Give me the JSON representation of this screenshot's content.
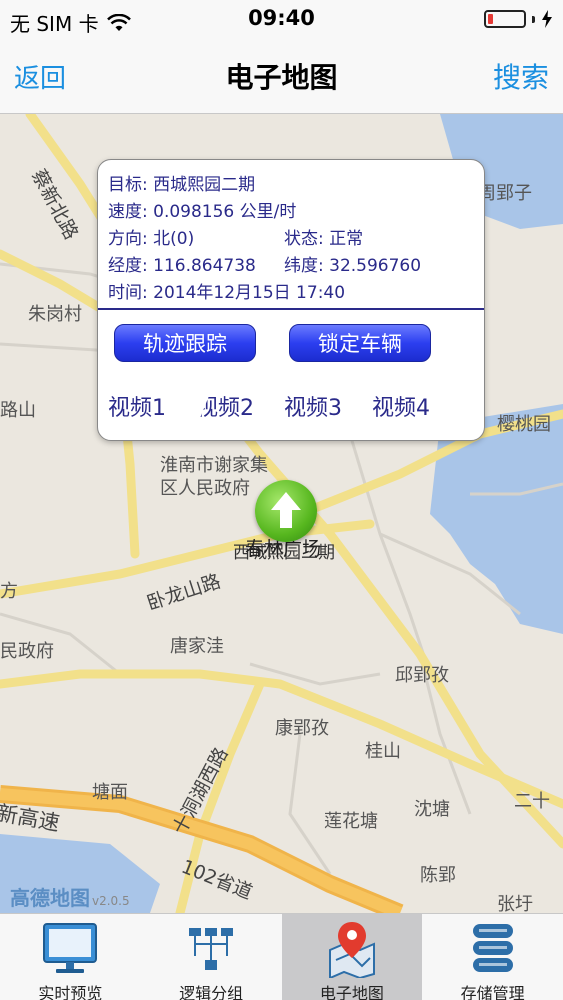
{
  "status_bar": {
    "carrier": "无 SIM 卡",
    "time": "09:40"
  },
  "nav": {
    "back": "返回",
    "title": "电子地图",
    "search": "搜索"
  },
  "popup": {
    "target": "目标: 西城熙园二期",
    "speed": "速度: 0.098156 公里/时",
    "direction": "方向: 北(0)",
    "state": "状态: 正常",
    "longitude": "经度: 116.864738",
    "latitude": "纬度: 32.596760",
    "time": "时间: 2014年12月15日 17:40",
    "track_button": "轨迹跟踪",
    "lock_button": "锁定车辆",
    "videos": [
      "视频1",
      "视频2",
      "视频3",
      "视频4"
    ]
  },
  "marker": {
    "label_a": "春林广场",
    "label_b": "西城熙园二期"
  },
  "map": {
    "labels": {
      "caixin": "蔡新北路",
      "zhougang": "朱岗村",
      "zhouying": "周郢子",
      "yingtao": "樱桃园",
      "lushan": "路山",
      "gov": "淮南市谢家集",
      "gov2": "区人民政府",
      "wolong": "卧龙山路",
      "tangjiawa": "唐家洼",
      "zhengfu": "民政府",
      "fang": "方",
      "qiuyingmei": "邱郢孜",
      "kangyingmei": "康郢孜",
      "guishan": "桂山",
      "tangmian": "塘面",
      "shidong": "十洞湖西路",
      "gaosu": "新高速",
      "lianhuatang": "莲花塘",
      "shentang": "沈塘",
      "ershi": "二十",
      "chenying": "陈郢",
      "zhangyu": "张圩",
      "shengdao": "102省道"
    },
    "logo": "高德地图",
    "version": "v2.0.5"
  },
  "tabs": [
    {
      "label": "实时预览",
      "icon": "monitor-icon"
    },
    {
      "label": "逻辑分组",
      "icon": "hierarchy-icon"
    },
    {
      "label": "电子地图",
      "icon": "map-pin-icon",
      "active": true
    },
    {
      "label": "存储管理",
      "icon": "database-icon"
    }
  ]
}
